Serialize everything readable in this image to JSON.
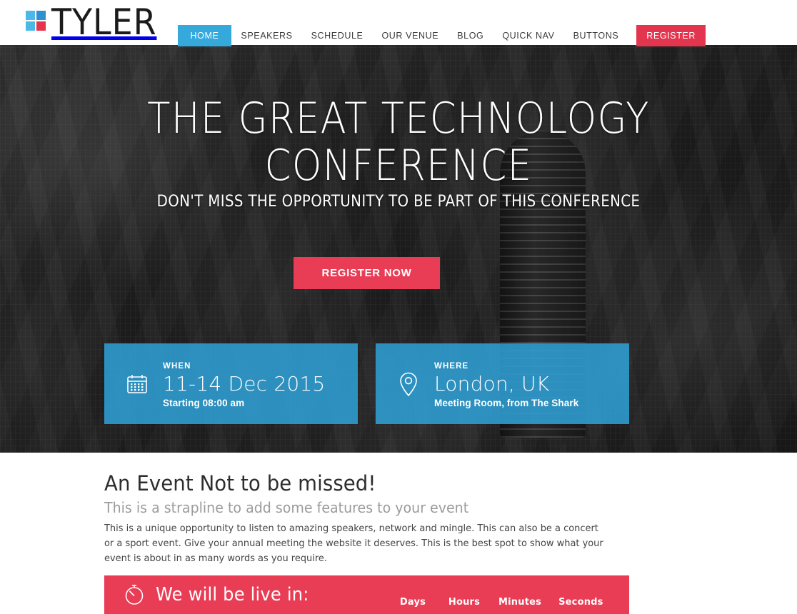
{
  "brand": {
    "name": "TYLER",
    "logo_colors": {
      "top_left": "#4cb8e8",
      "top_right": "#2f8fd0",
      "bottom_left": "#4cb8e8",
      "bottom_right": "#e4354f"
    }
  },
  "nav": {
    "items": [
      {
        "label": "HOME",
        "state": "active"
      },
      {
        "label": "SPEAKERS",
        "state": "default"
      },
      {
        "label": "SCHEDULE",
        "state": "default"
      },
      {
        "label": "OUR VENUE",
        "state": "default"
      },
      {
        "label": "BLOG",
        "state": "default"
      },
      {
        "label": "QUICK NAV",
        "state": "default"
      },
      {
        "label": "BUTTONS",
        "state": "default"
      }
    ],
    "register": {
      "label": "REGISTER"
    },
    "active_color": "#35a8dc",
    "register_color": "#e4354f"
  },
  "hero": {
    "title_line1": "THE GREAT TECHNOLOGY",
    "title_line2": "CONFERENCE",
    "subtitle": "DON'T MISS THE OPPORTUNITY TO BE PART OF THIS CONFERENCE",
    "cta_label": "REGISTER NOW",
    "cta_color": "#e93c55",
    "cards": [
      {
        "icon": "calendar-icon",
        "label": "WHEN",
        "main": "11-14 Dec 2015",
        "note": "Starting 08:00 am"
      },
      {
        "icon": "map-pin-icon",
        "label": "WHERE",
        "main": "London, UK",
        "note": "Meeting Room, from The Shark"
      }
    ],
    "card_color": "#2fa0d6"
  },
  "main": {
    "heading": "An Event Not to be missed!",
    "strapline": "This is a strapline to add some features to your event",
    "paragraph": "This is a unique opportunity to listen to amazing speakers, network and mingle. This can also be a concert or a sport event. Give your annual meeting the website it deserves. This is the best spot to show what your event is about in as many words as you require."
  },
  "countdown": {
    "icon": "stopwatch-icon",
    "title": "We will be live in:",
    "bar_color": "#e93c55",
    "units": [
      {
        "label": "Days",
        "value": ""
      },
      {
        "label": "Hours",
        "value": ""
      },
      {
        "label": "Minutes",
        "value": ""
      },
      {
        "label": "Seconds",
        "value": ""
      }
    ]
  }
}
